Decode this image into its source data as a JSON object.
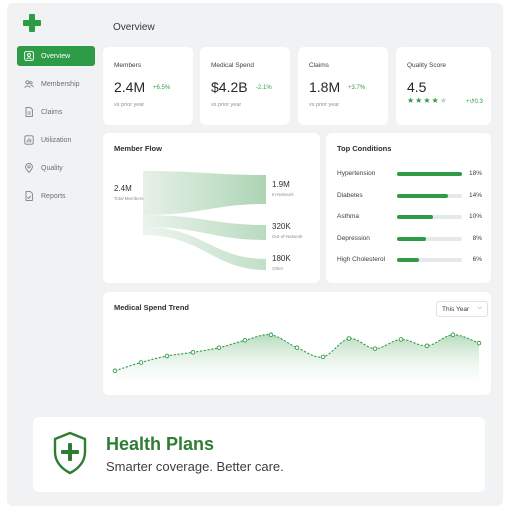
{
  "page": {
    "title": "Overview"
  },
  "sidebar": {
    "items": [
      {
        "label": "Overview",
        "icon": "user-icon",
        "active": true
      },
      {
        "label": "Membership",
        "icon": "members-icon",
        "active": false
      },
      {
        "label": "Claims",
        "icon": "document-icon",
        "active": false
      },
      {
        "label": "Utilization",
        "icon": "chart-icon",
        "active": false
      },
      {
        "label": "Quality",
        "icon": "location-pin-icon",
        "active": false
      },
      {
        "label": "Reports",
        "icon": "report-icon",
        "active": false
      }
    ]
  },
  "kpis": {
    "members": {
      "label": "Members",
      "value": "2.4M",
      "change": "+6.5%",
      "sub": "vs prior year"
    },
    "spend": {
      "label": "Medical Spend",
      "value": "$4.2B",
      "change": "-2.1%",
      "sub": "vs prior year"
    },
    "claims": {
      "label": "Claims",
      "value": "1.8M",
      "change": "+3.7%",
      "sub": "vs prior year"
    },
    "quality": {
      "label": "Quality Score",
      "value": "4.5",
      "stars_filled": 4,
      "stars_total": 5,
      "aside": "+↺0.3"
    }
  },
  "member_flow": {
    "title": "Member Flow",
    "total_value": "2.4M",
    "total_label": "Total Members",
    "outputs": [
      {
        "value": "1.9M",
        "label": "In-Network"
      },
      {
        "value": "320K",
        "label": "Out-of-Network"
      },
      {
        "value": "180K",
        "label": "Other"
      }
    ]
  },
  "top_conditions": {
    "title": "Top Conditions",
    "items": [
      {
        "name": "Hypertension",
        "pct": "18%",
        "value": 18
      },
      {
        "name": "Diabetes",
        "pct": "14%",
        "value": 14
      },
      {
        "name": "Asthma",
        "pct": "10%",
        "value": 10
      },
      {
        "name": "Depression",
        "pct": "8%",
        "value": 8
      },
      {
        "name": "High Cholesterol",
        "pct": "6%",
        "value": 6
      }
    ]
  },
  "spend_trend": {
    "title": "Medical Spend Trend",
    "range_label": "This Year",
    "range_options": [
      "This Year"
    ]
  },
  "chart_data": {
    "type": "area",
    "title": "Medical Spend Trend",
    "xlabel": "",
    "ylabel": "",
    "x": [
      1,
      2,
      3,
      4,
      5,
      6,
      7,
      8,
      9,
      10,
      11,
      12,
      13,
      14,
      15
    ],
    "values": [
      10,
      19,
      26,
      30,
      35,
      43,
      49,
      35,
      25,
      45,
      34,
      44,
      37,
      49,
      40
    ],
    "ylim": [
      0,
      65
    ],
    "grid": false,
    "legend": "none"
  },
  "brand": {
    "title": "Health Plans",
    "tagline": "Smarter coverage. Better care.",
    "icon": "shield-plus-icon"
  },
  "colors": {
    "accent": "#2e9c46",
    "brand_text": "#2e7d32",
    "background": "#f1f2f3",
    "card": "#ffffff"
  }
}
